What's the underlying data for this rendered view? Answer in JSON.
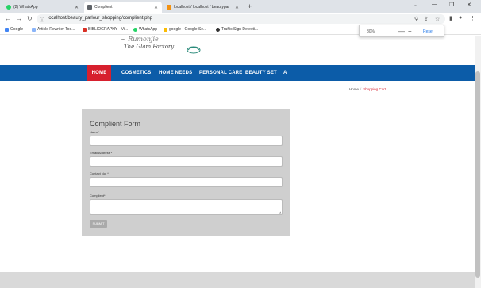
{
  "browser": {
    "tabs": [
      {
        "label": "(2) WhatsApp",
        "color": "#25d366"
      },
      {
        "label": "Complient",
        "color": "#5f6368"
      },
      {
        "label": "localhost / localhost / beautypar",
        "color": "#f29111"
      }
    ],
    "url": "localhost/beauty_parlour_shopping/complient.php",
    "bookmarks": [
      {
        "label": "Google",
        "icon": "google-icon",
        "color": "#4285f4"
      },
      {
        "label": "Article Rewriter Too...",
        "icon": "doc-icon",
        "color": "#8ab4f8"
      },
      {
        "label": "BIBLIOGRAPHY - Vi...",
        "icon": "bib-icon",
        "color": "#d93025"
      },
      {
        "label": "WhatsApp",
        "icon": "whatsapp-icon",
        "color": "#25d366"
      },
      {
        "label": "google - Google Se...",
        "icon": "google-icon",
        "color": "#fbbc05"
      },
      {
        "label": "Traffic Sign Detecti...",
        "icon": "github-icon",
        "color": "#333"
      }
    ],
    "zoom": {
      "value": "80%",
      "minus": "—",
      "plus": "+",
      "reset": "Reset"
    }
  },
  "site": {
    "logo_subtitle": "The Glam Factory",
    "nav": [
      {
        "label": "HOME"
      },
      {
        "label": "COSMETICS"
      },
      {
        "label": "HOME NEEDS"
      },
      {
        "label": "PERSONAL CARE"
      },
      {
        "label": "BEAUTY SET"
      },
      {
        "label": "A"
      }
    ],
    "breadcrumb": {
      "home": "Home",
      "sep": "/",
      "current": "Shopping Cart"
    },
    "form": {
      "title": "Complient Form",
      "fields": [
        {
          "label": "Name*",
          "value": ""
        },
        {
          "label": "Email Address *",
          "value": ""
        },
        {
          "label": "Contact No. *",
          "value": ""
        },
        {
          "label": "Complient*",
          "value": ""
        }
      ],
      "submit": "SUBMIT"
    }
  },
  "colors": {
    "nav_bg": "#0c5ca8",
    "nav_active": "#d7202e",
    "form_bg": "#cfcfcf"
  }
}
